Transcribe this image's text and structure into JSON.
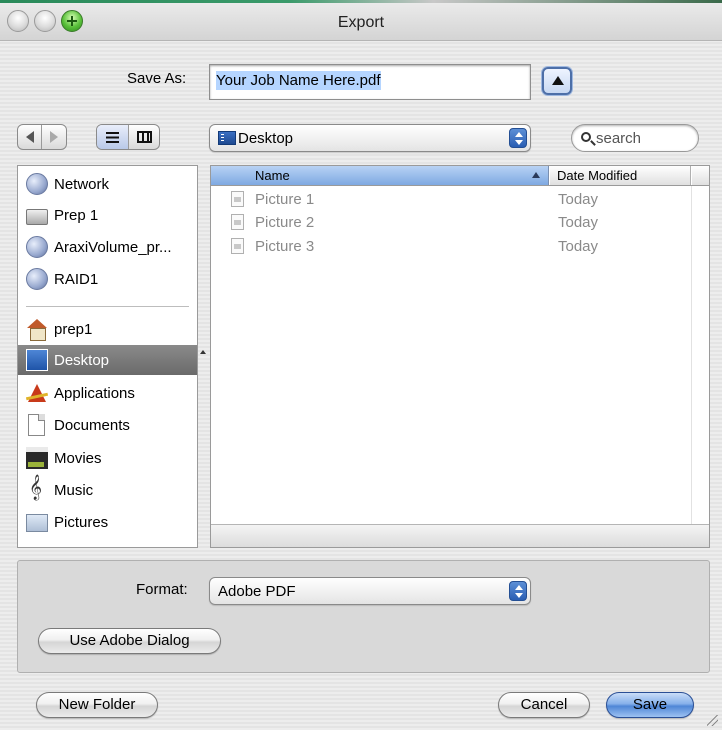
{
  "window": {
    "title": "Export"
  },
  "save_as": {
    "label": "Save As:",
    "value": "Your Job Name Here.pdf"
  },
  "toolbar": {
    "location": "Desktop",
    "search_placeholder": "search"
  },
  "sidebar": {
    "devices": [
      {
        "label": "Network",
        "icon": "network-globe-icon"
      },
      {
        "label": "Prep 1",
        "icon": "hard-disk-icon"
      },
      {
        "label": "AraxiVolume_pr...",
        "icon": "network-volume-icon"
      },
      {
        "label": "RAID1",
        "icon": "network-volume-icon"
      }
    ],
    "places": [
      {
        "label": "prep1",
        "icon": "home-icon"
      },
      {
        "label": "Desktop",
        "icon": "desktop-icon",
        "selected": true
      },
      {
        "label": "Applications",
        "icon": "applications-icon"
      },
      {
        "label": "Documents",
        "icon": "documents-icon"
      },
      {
        "label": "Movies",
        "icon": "movies-icon"
      },
      {
        "label": "Music",
        "icon": "music-icon"
      },
      {
        "label": "Pictures",
        "icon": "pictures-icon"
      }
    ]
  },
  "file_list": {
    "columns": {
      "name": "Name",
      "date": "Date Modified"
    },
    "rows": [
      {
        "name": "Picture 1",
        "date": "Today"
      },
      {
        "name": "Picture 2",
        "date": "Today"
      },
      {
        "name": "Picture 3",
        "date": "Today"
      }
    ]
  },
  "accessory": {
    "format_label": "Format:",
    "format_value": "Adobe PDF",
    "adobe_dialog_label": "Use Adobe Dialog"
  },
  "buttons": {
    "new_folder": "New Folder",
    "cancel": "Cancel",
    "save": "Save"
  },
  "colors": {
    "accent_blue": "#4f86d6",
    "selection_gray": "#7a7a7a",
    "text_selection": "#b5d5ff"
  }
}
